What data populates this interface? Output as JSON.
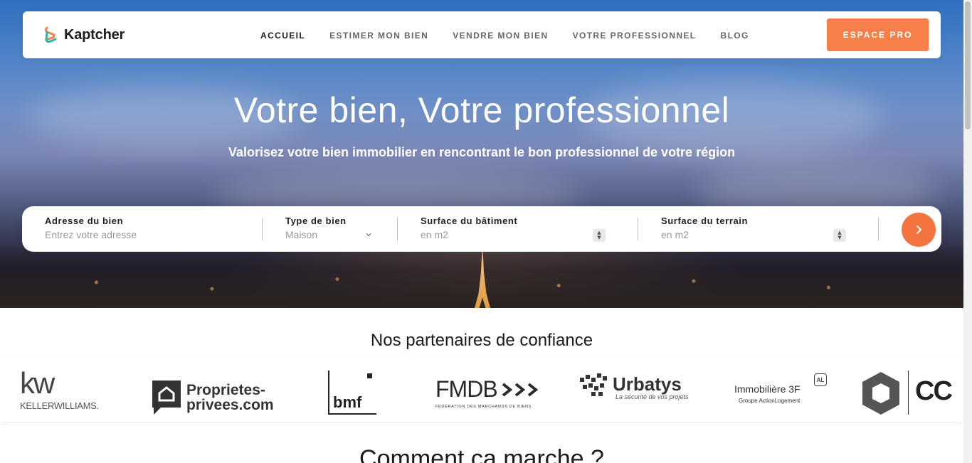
{
  "brand": {
    "name": "Kaptcher",
    "accent": "#f7804a"
  },
  "nav": {
    "items": [
      {
        "label": "ACCUEIL",
        "active": true
      },
      {
        "label": "ESTIMER MON BIEN",
        "active": false
      },
      {
        "label": "VENDRE MON BIEN",
        "active": false
      },
      {
        "label": "VOTRE PROFESSIONNEL",
        "active": false
      },
      {
        "label": "BLOG",
        "active": false
      }
    ],
    "cta_label": "ESPACE PRO"
  },
  "hero": {
    "title": "Votre bien, Votre professionnel",
    "subtitle": "Valorisez votre bien immobilier en rencontrant le bon professionnel de votre région"
  },
  "search": {
    "address": {
      "label": "Adresse du bien",
      "placeholder": "Entrez votre adresse"
    },
    "type": {
      "label": "Type de bien",
      "value": "Maison"
    },
    "building": {
      "label": "Surface du bâtiment",
      "placeholder": "en m2"
    },
    "land": {
      "label": "Surface du terrain",
      "placeholder": "en m2"
    },
    "submit_icon": "chevron-right-icon"
  },
  "partners": {
    "title": "Nos partenaires de confiance",
    "logos": [
      {
        "name": "keller-williams",
        "line1": "kw",
        "line2": "KELLERWILLIAMS."
      },
      {
        "name": "proprietes-privees",
        "line1": "Proprietes-",
        "line2": "privees.com"
      },
      {
        "name": "bmf",
        "line1": "bmf"
      },
      {
        "name": "fmdb",
        "line1": "FMDB",
        "line2": "FÉDÉRATION DES MARCHANDS DE BIENS"
      },
      {
        "name": "urbatys",
        "line1": "Urbatys",
        "line2": "La sécurité de vos projets"
      },
      {
        "name": "immobiliere-3f",
        "line1": "Immobilière 3F",
        "line2": "Groupe ActionLogement",
        "badge": "AL"
      },
      {
        "name": "cc",
        "line1": "CC"
      }
    ]
  },
  "how": {
    "title": "Comment ça marche ?"
  }
}
